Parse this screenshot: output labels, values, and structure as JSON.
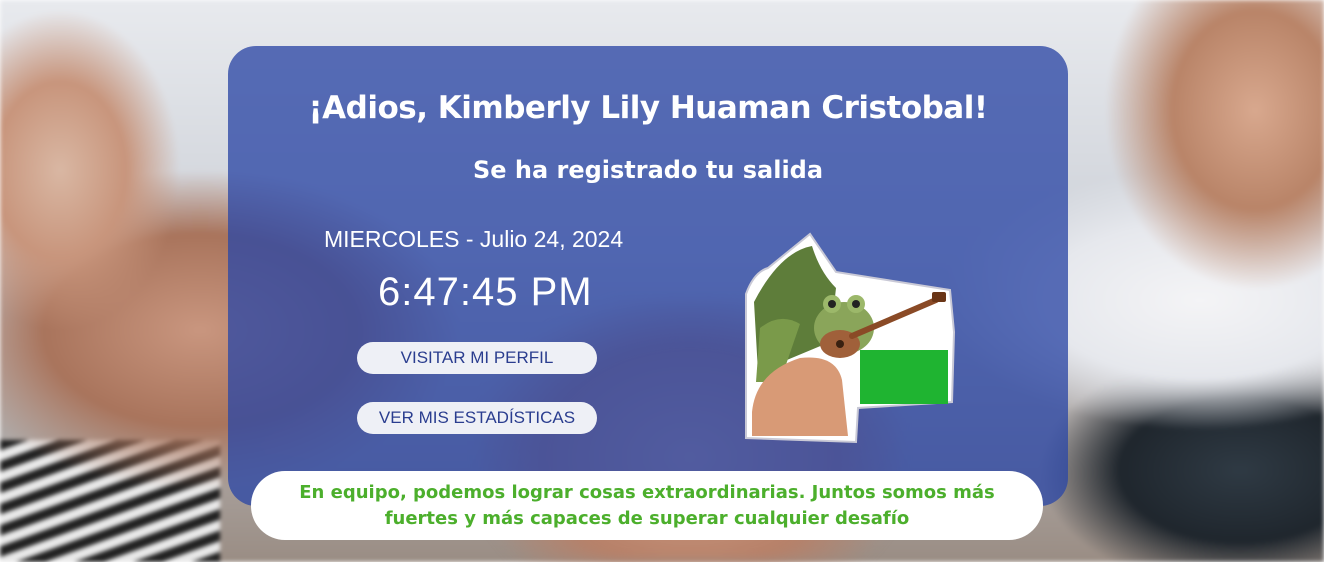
{
  "greeting": {
    "title": "¡Adios, Kimberly Lily Huaman Cristobal!",
    "subtitle": "Se ha registrado tu salida"
  },
  "clock": {
    "date": "MIERCOLES - Julio 24, 2024",
    "time": "6:47:45 PM"
  },
  "actions": {
    "profile_label": "VISITAR MI PERFIL",
    "stats_label": "VER MIS ESTADÍSTICAS"
  },
  "quote": {
    "text": "En equipo, podemos lograr cosas extraordinarias. Juntos somos más fuertes y más capaces de superar cualquier desafío"
  },
  "colors": {
    "card": "#2d48a5",
    "button_text": "#2a3d8f",
    "quote_text": "#4caf2c"
  },
  "icons": {
    "sticker": "frog-playing-guitar-sticker"
  }
}
